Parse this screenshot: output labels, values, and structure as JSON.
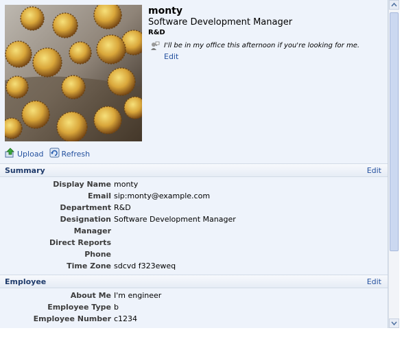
{
  "profile": {
    "name": "monty",
    "title": "Software Development Manager",
    "department": "R&D",
    "status_text": "I'll be in my office this afternoon if you're looking for me.",
    "status_edit": "Edit"
  },
  "toolbar": {
    "upload": "Upload",
    "refresh": "Refresh"
  },
  "summary": {
    "title": "Summary",
    "edit": "Edit",
    "fields": [
      {
        "label": "Display Name",
        "value": "monty"
      },
      {
        "label": "Email",
        "value": "sip:monty@example.com"
      },
      {
        "label": "Department",
        "value": "R&D"
      },
      {
        "label": "Designation",
        "value": "Software Development Manager"
      },
      {
        "label": "Manager",
        "value": ""
      },
      {
        "label": "Direct Reports",
        "value": ""
      },
      {
        "label": "Phone",
        "value": ""
      },
      {
        "label": "Time Zone",
        "value": "sdcvd f323eweq"
      }
    ]
  },
  "employee": {
    "title": "Employee",
    "edit": "Edit",
    "fields": [
      {
        "label": "About Me",
        "value": "I'm engineer"
      },
      {
        "label": "Employee Type",
        "value": "b"
      },
      {
        "label": "Employee Number",
        "value": "c1234"
      }
    ]
  },
  "icons": {
    "status": "person-speech-icon",
    "upload": "upload-icon",
    "refresh": "refresh-icon"
  }
}
